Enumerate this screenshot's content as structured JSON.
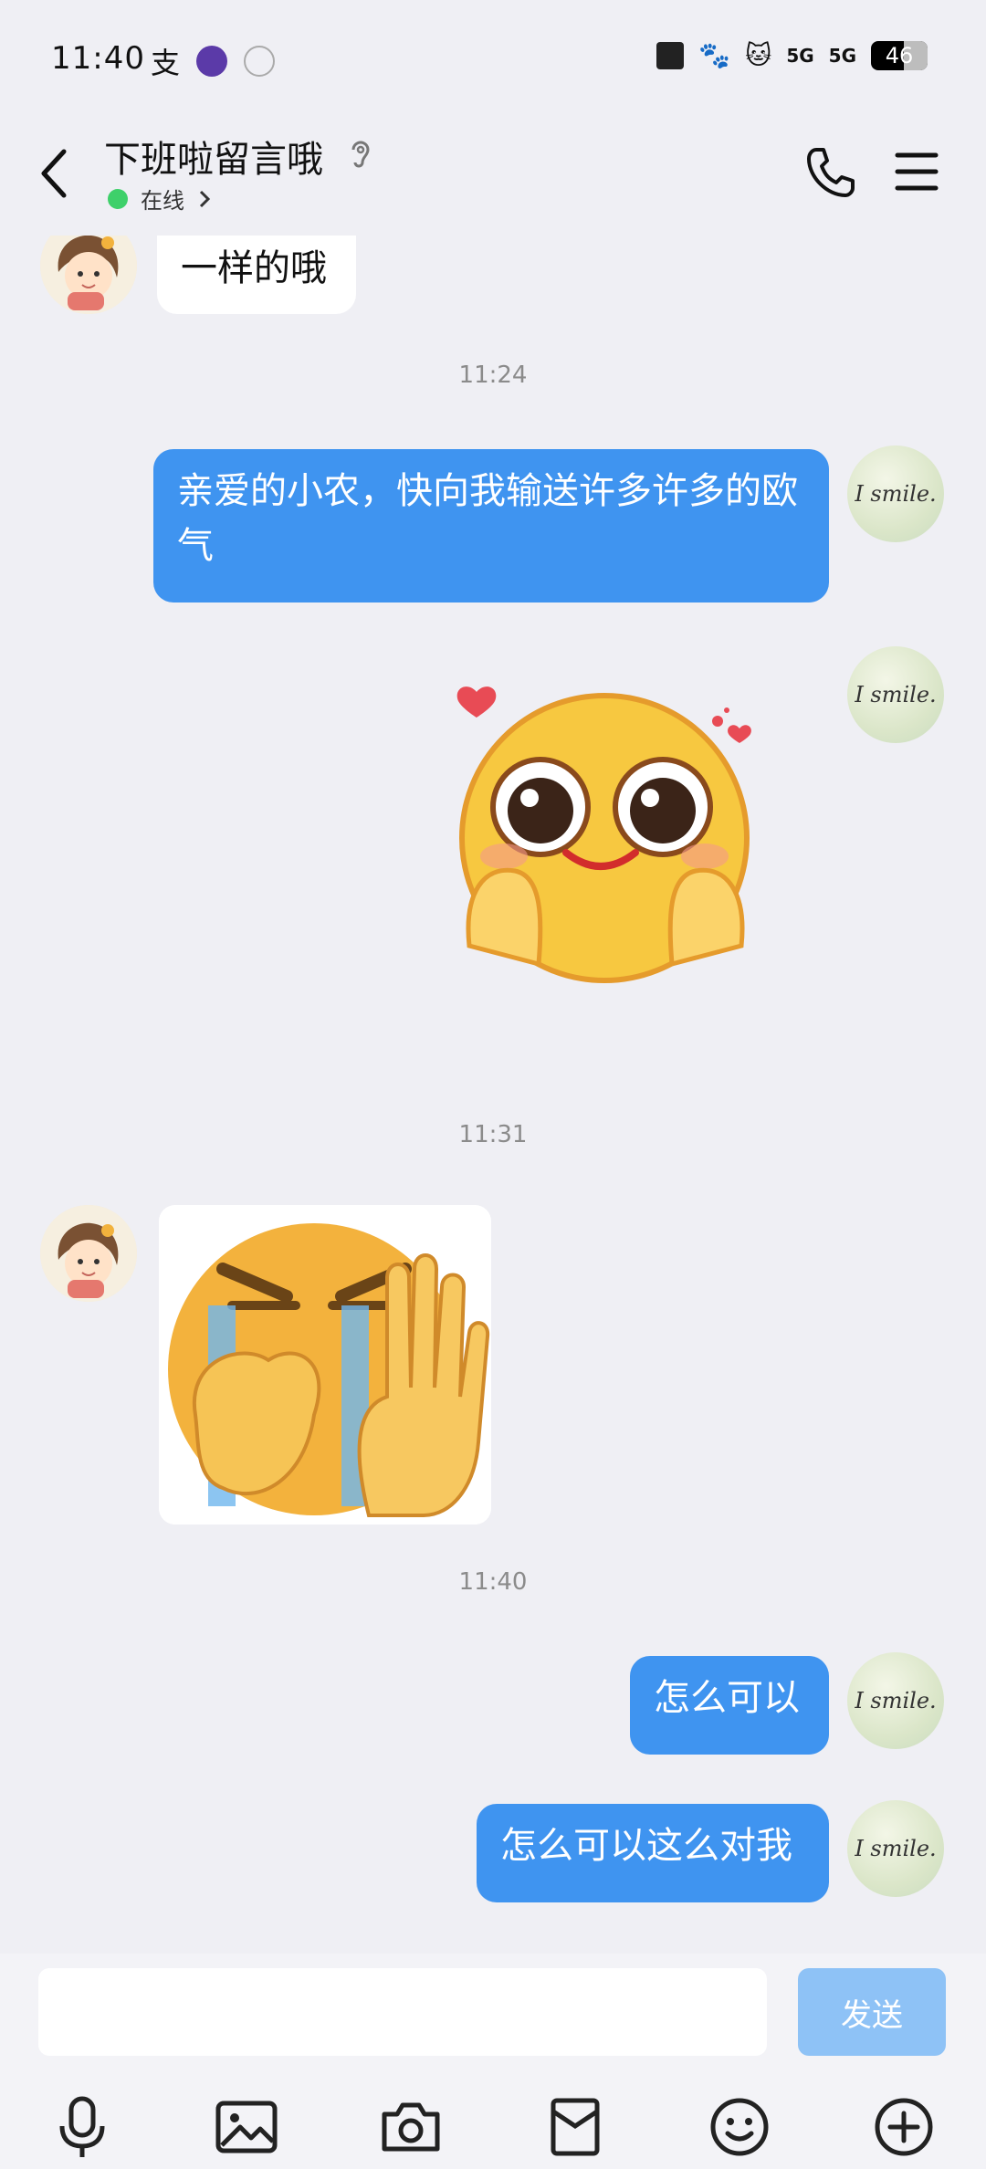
{
  "status": {
    "time": "11:40",
    "sig1": "5G",
    "sig2": "5G",
    "battery": "46"
  },
  "header": {
    "title": "下班啦留言哦",
    "presence": "在线"
  },
  "messages": {
    "m1_text": "一样的哦",
    "ts1": "11:24",
    "m2_text": "亲爱的小农，快向我输送许多许多的欧气",
    "ts2": "11:31",
    "ts3": "11:40",
    "m5_text": "怎么可以",
    "m6_text": "怎么可以这么对我"
  },
  "avatar": {
    "me_text": "I smile."
  },
  "composer": {
    "send_label": "发送"
  },
  "colors": {
    "out_bubble": "#3f94f0",
    "send_button": "#8ec2f6",
    "online_dot": "#3ed06a"
  }
}
